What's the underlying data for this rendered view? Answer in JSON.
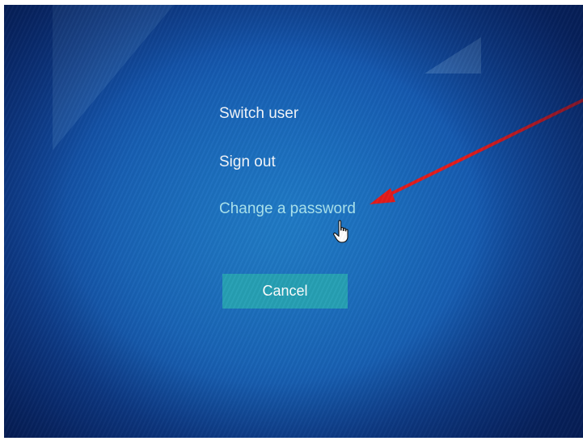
{
  "menu": {
    "switch_user": "Switch user",
    "sign_out": "Sign out",
    "change_password": "Change a password"
  },
  "cancel_button": {
    "label": "Cancel"
  },
  "colors": {
    "background": "#1559b0",
    "button": "#26a0b4",
    "highlight_text": "#a9e3ee",
    "annotation_arrow": "#e31b1b"
  },
  "icons": {
    "cursor": "hand-pointer-icon",
    "annotation": "red-arrow"
  }
}
